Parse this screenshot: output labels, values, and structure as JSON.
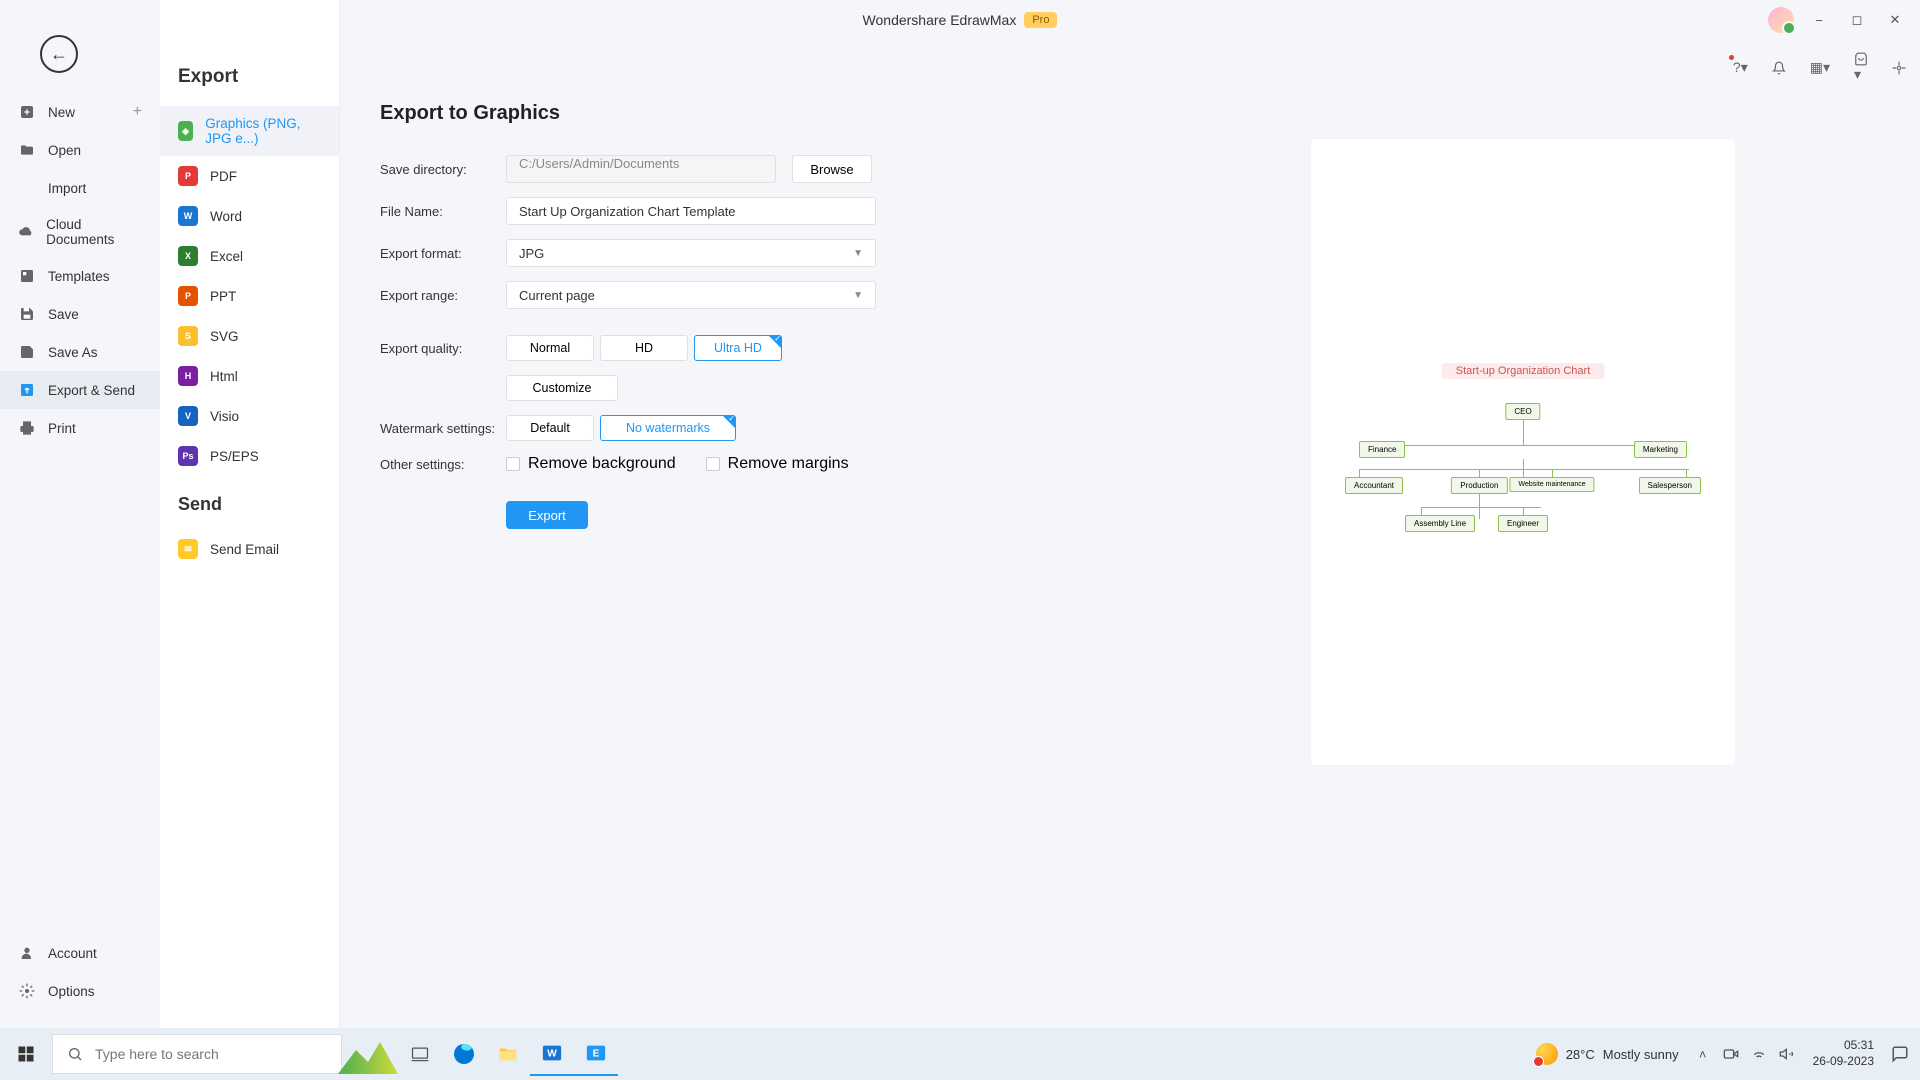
{
  "app": {
    "title": "Wondershare EdrawMax",
    "pro_badge": "Pro"
  },
  "leftnav": {
    "new": "New",
    "open": "Open",
    "import": "Import",
    "cloud_documents": "Cloud Documents",
    "templates": "Templates",
    "save": "Save",
    "save_as": "Save As",
    "export_send": "Export & Send",
    "print": "Print",
    "account": "Account",
    "options": "Options"
  },
  "exportcol": {
    "heading": "Export",
    "graphics": "Graphics (PNG, JPG e...)",
    "pdf": "PDF",
    "word": "Word",
    "excel": "Excel",
    "ppt": "PPT",
    "svg": "SVG",
    "html": "Html",
    "visio": "Visio",
    "pseps": "PS/EPS",
    "send_heading": "Send",
    "send_email": "Send Email"
  },
  "main": {
    "title": "Export to Graphics",
    "save_directory_label": "Save directory:",
    "save_directory_value": "C:/Users/Admin/Documents",
    "browse_label": "Browse",
    "file_name_label": "File Name:",
    "file_name_value": "Start Up Organization Chart Template",
    "export_format_label": "Export format:",
    "export_format_value": "JPG",
    "export_range_label": "Export range:",
    "export_range_value": "Current page",
    "export_quality_label": "Export quality:",
    "quality_normal": "Normal",
    "quality_hd": "HD",
    "quality_ultra": "Ultra HD",
    "customize_label": "Customize",
    "watermark_label": "Watermark settings:",
    "watermark_default": "Default",
    "watermark_none": "No watermarks",
    "other_settings_label": "Other settings:",
    "remove_bg": "Remove background",
    "remove_margins": "Remove margins",
    "export_btn": "Export"
  },
  "chart_data": {
    "type": "tree",
    "title": "Start-up Organization Chart",
    "nodes": {
      "root": "CEO",
      "l2_left": "Finance",
      "l2_right": "Marketing",
      "l3_1": "Accountant",
      "l3_2": "Production",
      "l3_3": "Website maintenance",
      "l3_4": "Salesperson",
      "l4_1": "Assembly Line",
      "l4_2": "Engineer"
    }
  },
  "taskbar": {
    "search_placeholder": "Type here to search",
    "weather_temp": "28°C",
    "weather_desc": "Mostly sunny",
    "time": "05:31",
    "date": "26-09-2023"
  }
}
